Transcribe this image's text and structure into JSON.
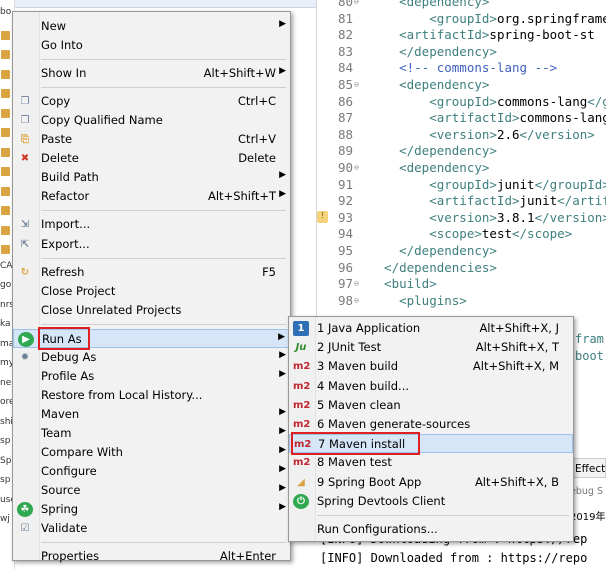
{
  "explorer": {
    "rows": [
      "bo",
      "",
      "",
      "",
      "",
      "",
      "",
      "",
      "",
      "",
      "",
      "",
      "",
      "CA",
      "go",
      "nrs",
      "ka",
      "ma",
      "my",
      "ne",
      "ore",
      "shi",
      "sp",
      "Sp",
      "sp",
      "use",
      "wj"
    ]
  },
  "editor": {
    "lines": [
      {
        "n": "80",
        "fold": "⊖",
        "parts": [
          [
            "tag",
            "    <dependency>"
          ]
        ]
      },
      {
        "n": "81",
        "fold": "",
        "parts": [
          [
            "tag",
            "        <groupId>"
          ],
          [
            "txt",
            "org.springframe"
          ]
        ]
      },
      {
        "n": "82",
        "fold": "",
        "parts": [
          [
            "tag",
            "    <artifactId>"
          ],
          [
            "txt",
            "spring-boot-st"
          ]
        ]
      },
      {
        "n": "83",
        "fold": "",
        "parts": [
          [
            "tag",
            "    </dependency>"
          ]
        ]
      },
      {
        "n": "84",
        "fold": "",
        "parts": [
          [
            "cmt",
            "    <!-- commons-lang -->"
          ]
        ]
      },
      {
        "n": "85",
        "fold": "⊖",
        "parts": [
          [
            "tag",
            "    <dependency>"
          ]
        ]
      },
      {
        "n": "86",
        "fold": "",
        "parts": [
          [
            "tag",
            "        <groupId>"
          ],
          [
            "txt",
            "commons-lang"
          ],
          [
            "tag",
            "</gr"
          ]
        ]
      },
      {
        "n": "87",
        "fold": "",
        "parts": [
          [
            "tag",
            "        <artifactId>"
          ],
          [
            "txt",
            "commons-lang"
          ],
          [
            "tag",
            "</"
          ]
        ]
      },
      {
        "n": "88",
        "fold": "",
        "parts": [
          [
            "tag",
            "        <version>"
          ],
          [
            "txt",
            "2.6"
          ],
          [
            "tag",
            "</version>"
          ]
        ]
      },
      {
        "n": "89",
        "fold": "",
        "parts": [
          [
            "tag",
            "    </dependency>"
          ]
        ]
      },
      {
        "n": "90",
        "fold": "⊖",
        "parts": [
          [
            "tag",
            "    <dependency>"
          ]
        ]
      },
      {
        "n": "91",
        "fold": "",
        "parts": [
          [
            "tag",
            "        <groupId>"
          ],
          [
            "txt",
            "junit"
          ],
          [
            "tag",
            "</groupId>"
          ]
        ]
      },
      {
        "n": "92",
        "fold": "",
        "parts": [
          [
            "tag",
            "        <artifactId>"
          ],
          [
            "txt",
            "junit"
          ],
          [
            "tag",
            "</artifa"
          ]
        ]
      },
      {
        "n": "93",
        "fold": "",
        "parts": [
          [
            "tag",
            "        <version>"
          ],
          [
            "txt",
            "3.8.1"
          ],
          [
            "tag",
            "</version>"
          ]
        ]
      },
      {
        "n": "94",
        "fold": "",
        "parts": [
          [
            "tag",
            "        <scope>"
          ],
          [
            "txt",
            "test"
          ],
          [
            "tag",
            "</scope>"
          ]
        ]
      },
      {
        "n": "95",
        "fold": "",
        "parts": [
          [
            "tag",
            "    </dependency>"
          ]
        ]
      },
      {
        "n": "96",
        "fold": "",
        "parts": [
          [
            "tag",
            "  </dependencies>"
          ]
        ]
      },
      {
        "n": "97",
        "fold": "⊖",
        "parts": [
          [
            "tag",
            "  <build>"
          ]
        ]
      },
      {
        "n": "98",
        "fold": "⊖",
        "parts": [
          [
            "tag",
            "    <plugins>"
          ]
        ]
      }
    ],
    "warning_line": "93",
    "tail": [
      "fram",
      "boot"
    ]
  },
  "console": {
    "tab": "Effecti",
    "sub": "ebug S",
    "date": "2019年",
    "lines": [
      "[INFO] Downloading from : https://rep",
      "[INFO] Downloaded from : https://repo"
    ]
  },
  "main_menu": [
    {
      "label": "New",
      "acc": "",
      "arrow": true,
      "icon": ""
    },
    {
      "label": "Go Into",
      "acc": "",
      "arrow": false,
      "icon": ""
    },
    {
      "sep": true
    },
    {
      "label": "Show In",
      "acc": "Alt+Shift+W",
      "arrow": true,
      "icon": ""
    },
    {
      "sep": true
    },
    {
      "label": "Copy",
      "acc": "Ctrl+C",
      "arrow": false,
      "icon": "copy"
    },
    {
      "label": "Copy Qualified Name",
      "acc": "",
      "arrow": false,
      "icon": "copy"
    },
    {
      "label": "Paste",
      "acc": "Ctrl+V",
      "arrow": false,
      "icon": "paste"
    },
    {
      "label": "Delete",
      "acc": "Delete",
      "arrow": false,
      "icon": "delete"
    },
    {
      "label": "Build Path",
      "acc": "",
      "arrow": true,
      "icon": ""
    },
    {
      "label": "Refactor",
      "acc": "Alt+Shift+T",
      "arrow": true,
      "icon": ""
    },
    {
      "sep": true
    },
    {
      "label": "Import...",
      "acc": "",
      "arrow": false,
      "icon": "import"
    },
    {
      "label": "Export...",
      "acc": "",
      "arrow": false,
      "icon": "export"
    },
    {
      "sep": true
    },
    {
      "label": "Refresh",
      "acc": "F5",
      "arrow": false,
      "icon": "refresh"
    },
    {
      "label": "Close Project",
      "acc": "",
      "arrow": false,
      "icon": ""
    },
    {
      "label": "Close Unrelated Projects",
      "acc": "",
      "arrow": false,
      "icon": ""
    },
    {
      "sep": true
    },
    {
      "label": "Run As",
      "acc": "",
      "arrow": true,
      "icon": "run",
      "highlight": true
    },
    {
      "label": "Debug As",
      "acc": "",
      "arrow": true,
      "icon": "debug"
    },
    {
      "label": "Profile As",
      "acc": "",
      "arrow": true,
      "icon": ""
    },
    {
      "label": "Restore from Local History...",
      "acc": "",
      "arrow": false,
      "icon": ""
    },
    {
      "label": "Maven",
      "acc": "",
      "arrow": true,
      "icon": ""
    },
    {
      "label": "Team",
      "acc": "",
      "arrow": true,
      "icon": ""
    },
    {
      "label": "Compare With",
      "acc": "",
      "arrow": true,
      "icon": ""
    },
    {
      "label": "Configure",
      "acc": "",
      "arrow": true,
      "icon": ""
    },
    {
      "label": "Source",
      "acc": "",
      "arrow": true,
      "icon": ""
    },
    {
      "label": "Spring",
      "acc": "",
      "arrow": true,
      "icon": "spring"
    },
    {
      "label": "Validate",
      "acc": "",
      "arrow": false,
      "icon": "validate"
    },
    {
      "sep": true
    },
    {
      "label": "Properties",
      "acc": "Alt+Enter",
      "arrow": false,
      "icon": ""
    }
  ],
  "sub_menu": [
    {
      "label": "1 Java Application",
      "acc": "Alt+Shift+X, J",
      "icon": "java",
      "icon_text": "1"
    },
    {
      "label": "2 JUnit Test",
      "acc": "Alt+Shift+X, T",
      "icon": "junit",
      "icon_text": "Ju"
    },
    {
      "label": "3 Maven build",
      "acc": "Alt+Shift+X, M",
      "icon": "m2",
      "icon_text": "m2"
    },
    {
      "label": "4 Maven build...",
      "acc": "",
      "icon": "m2",
      "icon_text": "m2"
    },
    {
      "label": "5 Maven clean",
      "acc": "",
      "icon": "m2",
      "icon_text": "m2"
    },
    {
      "label": "6 Maven generate-sources",
      "acc": "",
      "icon": "m2",
      "icon_text": "m2"
    },
    {
      "label": "7 Maven install",
      "acc": "",
      "icon": "m2",
      "icon_text": "m2",
      "highlight": true
    },
    {
      "label": "8 Maven test",
      "acc": "",
      "icon": "m2",
      "icon_text": "m2"
    },
    {
      "label": "9 Spring Boot App",
      "acc": "Alt+Shift+X, B",
      "icon": "boot",
      "icon_text": ""
    },
    {
      "label": "Spring Devtools Client",
      "acc": "",
      "icon": "devtools",
      "icon_text": ""
    },
    {
      "sep": true
    },
    {
      "label": "Run Configurations...",
      "acc": "",
      "icon": "",
      "icon_text": ""
    }
  ]
}
